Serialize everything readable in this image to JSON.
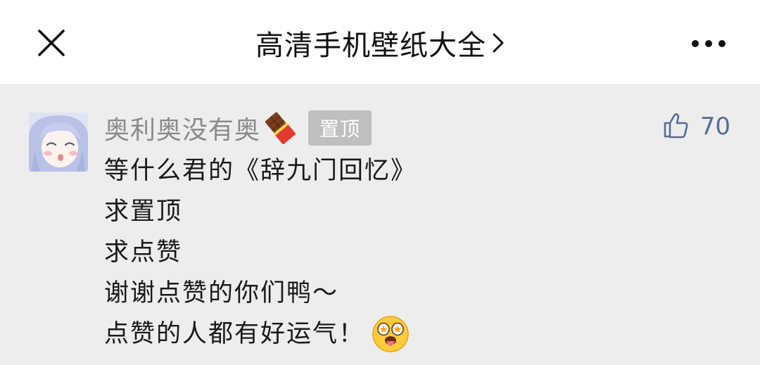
{
  "header": {
    "title": "高清手机壁纸大全",
    "close_icon": "close-icon",
    "more_icon": "more-horizontal-icon",
    "chevron_icon": "chevron-right-icon"
  },
  "comment": {
    "username": "奥利奥没有奥",
    "username_emoji": "chocolate-bar-icon",
    "pin_badge": "置顶",
    "likes": "70",
    "like_icon": "thumbs-up-icon",
    "lines": [
      "等什么君的《辞九门回忆》",
      "求置顶",
      "求点赞",
      "谢谢点赞的你们鸭～",
      "点赞的人都有好运气！"
    ],
    "trailing_emoji": "star-struck-tongue-emoji"
  },
  "colors": {
    "background": "#ededed",
    "header_bg": "#ffffff",
    "like_blue": "#576b95",
    "badge_gray": "#bfbfbf"
  }
}
